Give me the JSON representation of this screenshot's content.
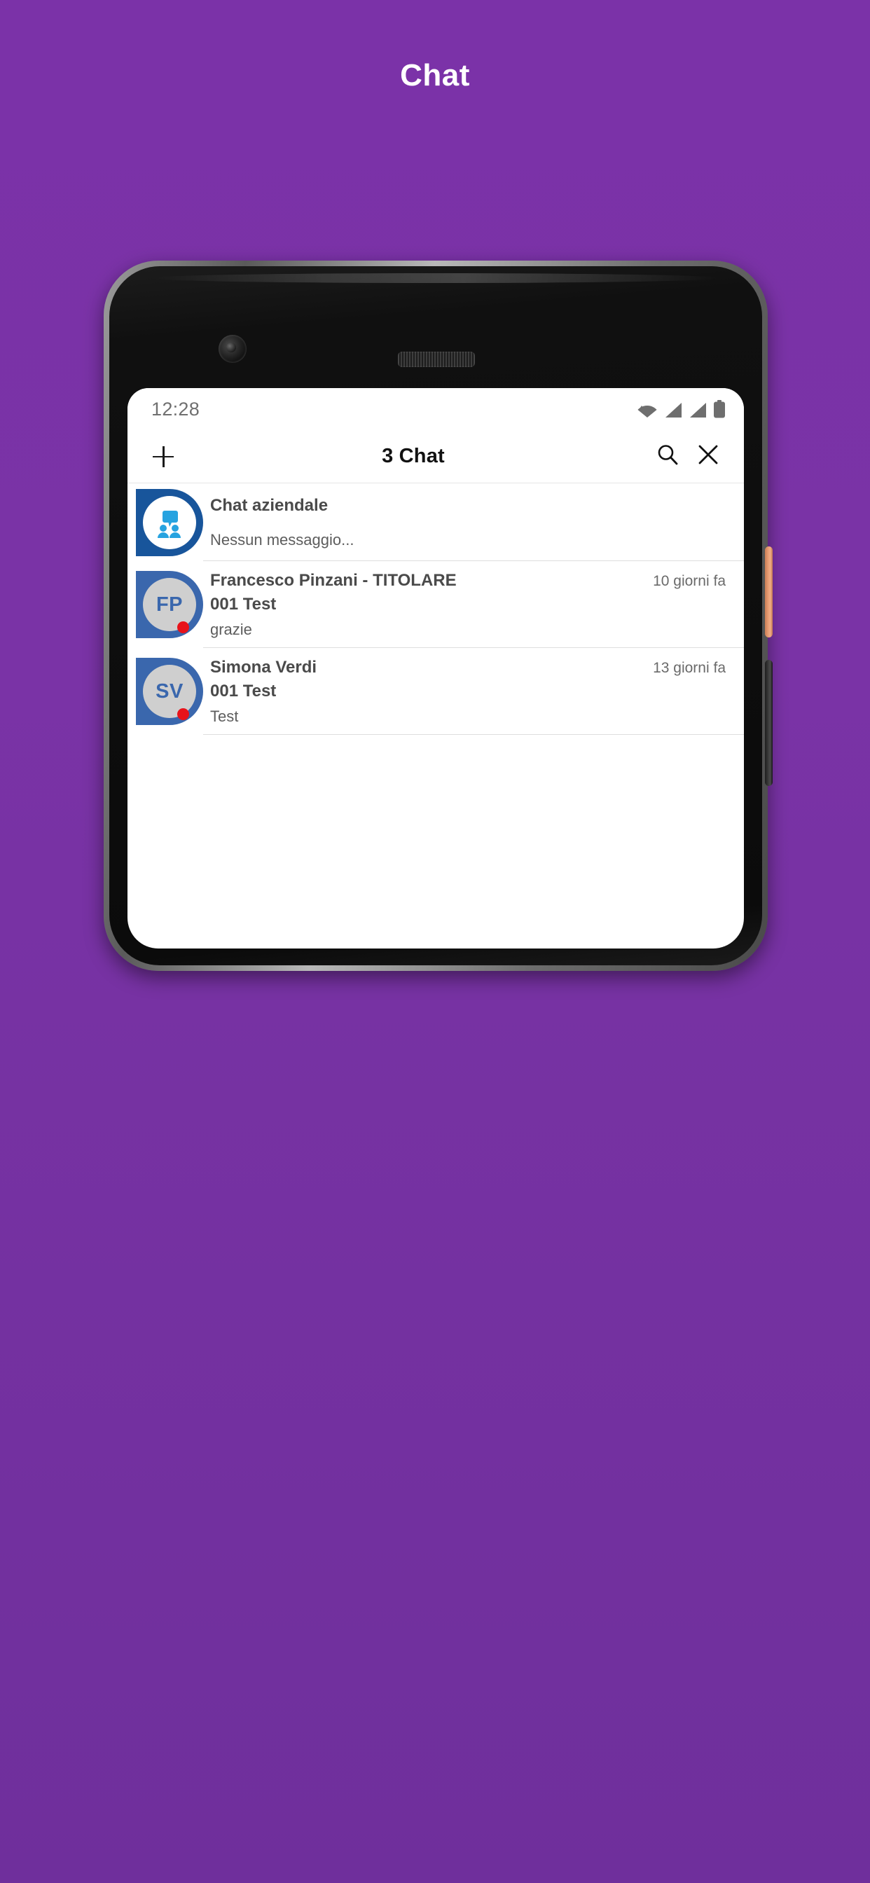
{
  "page": {
    "title": "Chat",
    "background_color": "#7a33a6"
  },
  "phone": {
    "buttons": {
      "power_label": "power-button",
      "volume_label": "volume-rocker"
    }
  },
  "statusbar": {
    "time": "12:28",
    "icons": [
      "wifi-icon",
      "signal-icon",
      "signal-icon",
      "battery-icon"
    ]
  },
  "appbar": {
    "add_label": "+",
    "title": "3 Chat",
    "search_label": "search-icon",
    "close_label": "close-icon"
  },
  "chats": [
    {
      "type": "group",
      "avatar_kind": "group-chat-icon",
      "initials": "",
      "name": "Chat aziendale",
      "subject": "",
      "preview": "Nessun messaggio...",
      "time": "",
      "status": ""
    },
    {
      "type": "direct",
      "avatar_kind": "initials-avatar",
      "initials": "FP",
      "name": "Francesco Pinzani - TITOLARE",
      "subject": "001 Test",
      "preview": "grazie",
      "time": "10 giorni fa",
      "status": "offline"
    },
    {
      "type": "direct",
      "avatar_kind": "initials-avatar",
      "initials": "SV",
      "name": "Simona Verdi",
      "subject": "001 Test",
      "preview": "Test",
      "time": "13 giorni fa",
      "status": "offline"
    }
  ],
  "colors": {
    "brand_purple": "#7a33a6",
    "avatar_blue": "#3a67ad",
    "group_avatar_blue": "#18559b",
    "group_icon_blue": "#27a3e0",
    "status_offline": "#e8131a",
    "power_button": "#e79b72"
  }
}
